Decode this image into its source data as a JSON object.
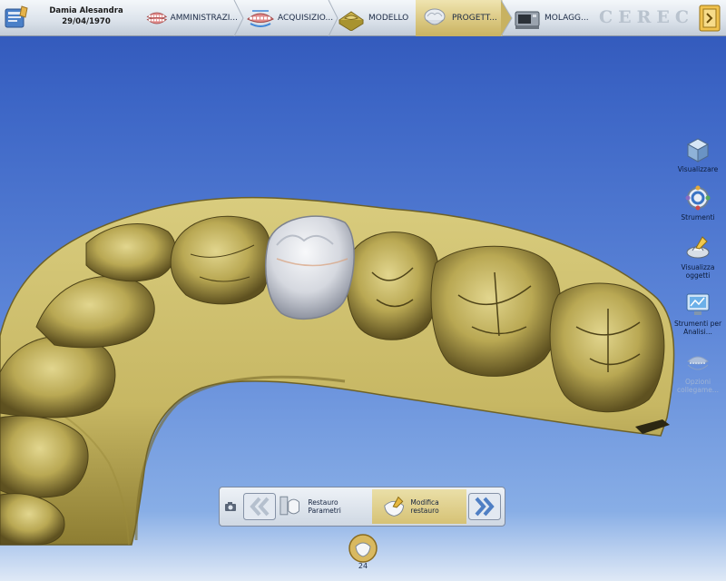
{
  "patient": {
    "name": "Damia Alesandra",
    "dob": "29/04/1970"
  },
  "steps": [
    {
      "label": "AMMINISTRAZI...",
      "icon": "dentures-icon"
    },
    {
      "label": "ACQUISIZIO...",
      "icon": "scan-dentures-icon"
    },
    {
      "label": "MODELLO",
      "icon": "model-icon"
    },
    {
      "label": "PROGETT...",
      "icon": "design-tooth-icon",
      "active": true
    },
    {
      "label": "MOLAGG...",
      "icon": "milling-unit-icon"
    }
  ],
  "brand": "CEREC",
  "right_tools": [
    {
      "label": "Visualizzare",
      "icon": "cube-view-icon"
    },
    {
      "label": "Strumenti",
      "icon": "tools-ring-icon"
    },
    {
      "label": "Visualizza oggetti",
      "icon": "objects-view-icon"
    },
    {
      "label": "Strumenti per Analisi...",
      "icon": "analysis-monitor-icon"
    },
    {
      "label": "Opzioni collegame...",
      "icon": "link-options-icon",
      "disabled": true
    }
  ],
  "workflow": {
    "items": [
      {
        "label": "Restauro Parametri",
        "icon": "parameters-tooth-icon"
      },
      {
        "label": "Modifica restauro",
        "icon": "edit-restoration-icon",
        "active": true
      }
    ]
  },
  "tooth_selector": {
    "number": "24"
  },
  "colors": {
    "accent_gold": "#d9c67e",
    "model_gold": "#cbbd6e",
    "background_blue": "#3d66c6"
  }
}
